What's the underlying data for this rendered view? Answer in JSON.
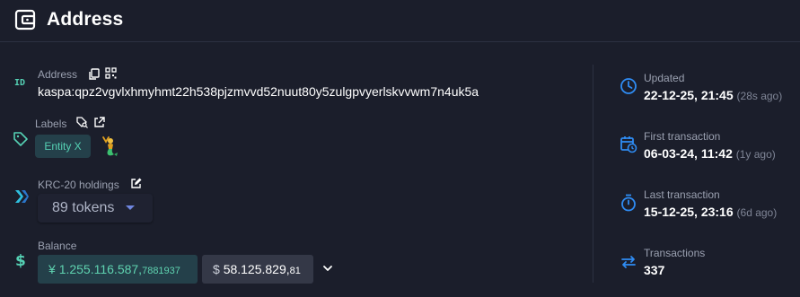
{
  "header": {
    "title": "Address",
    "icon": "wallet-icon"
  },
  "address": {
    "label": "Address",
    "value": "kaspa:qpz2vgvlxhmyhmt22h538pjzmvvd52nuut80y5zulgpvyerlskvvwm7n4uk5a",
    "icons": [
      "id-icon",
      "copy-icon",
      "qr-code-icon"
    ]
  },
  "labels": {
    "label": "Labels",
    "tag": "Entity X",
    "icons": [
      "tag-icon",
      "search-tag-icon",
      "external-link-icon",
      "mermaid-emoji-icon"
    ]
  },
  "krc20": {
    "label": "KRC-20 holdings",
    "selected": "89 tokens",
    "icons": [
      "krc20-icon",
      "edit-icon",
      "caret-down-icon"
    ]
  },
  "balance": {
    "label": "Balance",
    "kas_symbol": "¥",
    "kas_main": "1.255.116.587,",
    "kas_decimals": "7881937",
    "usd_symbol": "$",
    "usd_main": "58.125.829,",
    "usd_decimals": "81",
    "icons": [
      "dollar-icon",
      "chevron-down-icon"
    ]
  },
  "stats": {
    "updated": {
      "label": "Updated",
      "value": "22-12-25, 21:45",
      "ago": "(28s ago)",
      "icon": "clock-icon"
    },
    "first_tx": {
      "label": "First transaction",
      "value": "06-03-24, 11:42",
      "ago": "(1y ago)",
      "icon": "calendar-clock-icon"
    },
    "last_tx": {
      "label": "Last transaction",
      "value": "15-12-25, 23:16",
      "ago": "(6d ago)",
      "icon": "stopwatch-icon"
    },
    "transactions": {
      "label": "Transactions",
      "value": "337",
      "icon": "swap-arrows-icon"
    }
  },
  "colors": {
    "background": "#1b1e2b",
    "accent_blue": "#2f8cf3",
    "accent_green": "#55d1b4",
    "muted_text": "#9aa0b0"
  }
}
